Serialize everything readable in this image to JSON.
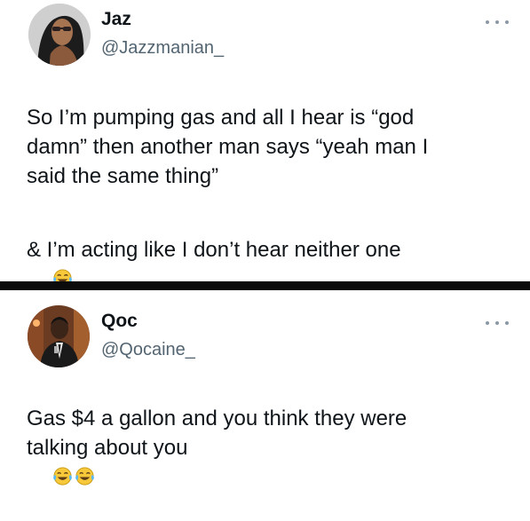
{
  "tweets": [
    {
      "display_name": "Jaz",
      "handle": "@Jazzmanian_",
      "text_paragraph_1": "So I’m pumping gas and all I hear is “god\ndamn” then another man says “yeah man I\nsaid the same thing”",
      "text_paragraph_2": "& I’m acting like I don’t hear neither one",
      "emojis": [
        "face-with-tears-of-joy"
      ],
      "avatar_icon": "profile-photo-woman-sunglasses"
    },
    {
      "display_name": "Qoc",
      "handle": "@Qocaine_",
      "text": "Gas $4 a gallon and you think they were\ntalking about you",
      "emojis": [
        "face-with-tears-of-joy",
        "face-with-tears-of-joy"
      ],
      "avatar_icon": "profile-photo-man-suit"
    }
  ],
  "icons": {
    "more_menu": "more-options-icon"
  },
  "colors": {
    "text": "#0f1419",
    "handle": "#536471",
    "divider": "#0b0b0b",
    "more_dots": "#8b98a5"
  }
}
